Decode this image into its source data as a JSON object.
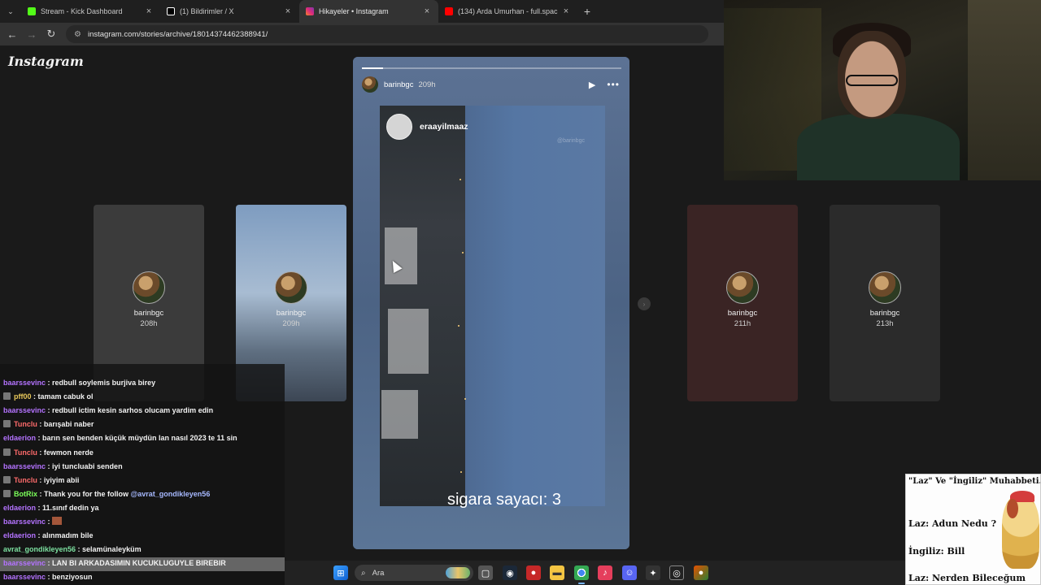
{
  "browser": {
    "tabs": [
      {
        "title": "Stream - Kick Dashboard",
        "favicon_color": "#53fc18"
      },
      {
        "title": "(1) Bildirimler / X",
        "favicon_color": "#ffffff"
      },
      {
        "title": "Hikayeler • Instagram",
        "favicon_color": "#e1306c"
      },
      {
        "title": "(134) Arda Umurhan - full.spac",
        "favicon_color": "#ff0000"
      }
    ],
    "url": "instagram.com/stories/archive/18014374462388941/"
  },
  "instagram": {
    "logo": "Instagram",
    "side_stories": [
      {
        "username": "barinbgc",
        "time": "208h"
      },
      {
        "username": "barinbgc",
        "time": "209h"
      },
      {
        "username": "barinbgc",
        "time": "211h"
      },
      {
        "username": "barinbgc",
        "time": "213h"
      }
    ],
    "story": {
      "username": "barinbgc",
      "time": "209h",
      "progress": 0.08,
      "tagged_user": "eraayilmaaz",
      "watermark": "@barinbgc",
      "caption": "sigara sayacı: 3"
    }
  },
  "chat": {
    "messages": [
      {
        "user": "baarssevinc",
        "color": "#b473ff",
        "text": " : redbull soylemis burjiva birey",
        "badge": false
      },
      {
        "user": "pff00",
        "color": "#e8c85a",
        "text": " : tamam cabuk ol",
        "badge": true
      },
      {
        "user": "baarssevinc",
        "color": "#b473ff",
        "text": " : redbull ictim kesin sarhos olucam yardim edin",
        "badge": false
      },
      {
        "user": "Tunclu",
        "color": "#ff6b6b",
        "text": " : barışabi naber",
        "badge": true
      },
      {
        "user": "eldaerion",
        "color": "#b473ff",
        "text": " : barın sen benden küçük müydün lan nasıl 2023 te 11 sin",
        "badge": false
      },
      {
        "user": "Tunclu",
        "color": "#ff6b6b",
        "text": " : fewmon nerde",
        "badge": true
      },
      {
        "user": "baarssevinc",
        "color": "#b473ff",
        "text": " : iyi tuncluabi senden",
        "badge": false
      },
      {
        "user": "Tunclu",
        "color": "#ff6b6b",
        "text": " : iyiyim abii",
        "badge": true
      },
      {
        "user": "BotRix",
        "color": "#7cff5a",
        "text": " : Thank you for the follow ",
        "mention": "@avrat_gondikleyen56",
        "badge": true
      },
      {
        "user": "eldaerion",
        "color": "#b473ff",
        "text": " : 11.sınıf dedin ya",
        "badge": false
      },
      {
        "user": "baarssevinc",
        "color": "#b473ff",
        "text": " : ",
        "emote": true,
        "badge": false
      },
      {
        "user": "eldaerion",
        "color": "#b473ff",
        "text": " : alınmadım bile",
        "badge": false
      },
      {
        "user": "avrat_gondikleyen56",
        "color": "#7ce0a0",
        "text": " : selamünaleyküm",
        "badge": false
      },
      {
        "user": "baarssevinc",
        "color": "#b473ff",
        "text": " : LAN BI ARKADASIMIN KUCUKLUGUYLE BIREBIR",
        "badge": false
      },
      {
        "user": "baarssevinc",
        "color": "#b473ff",
        "text": " : benziyosun",
        "badge": false
      }
    ]
  },
  "taskbar": {
    "search_placeholder": "Ara"
  },
  "meme": {
    "lines": [
      "\"Laz\" Ve \"İngiliz\" Muhabbeti..",
      "Laz: Adun Nedu ?",
      "İngiliz: Bill",
      "Laz: Nerden Bileceğum"
    ]
  }
}
